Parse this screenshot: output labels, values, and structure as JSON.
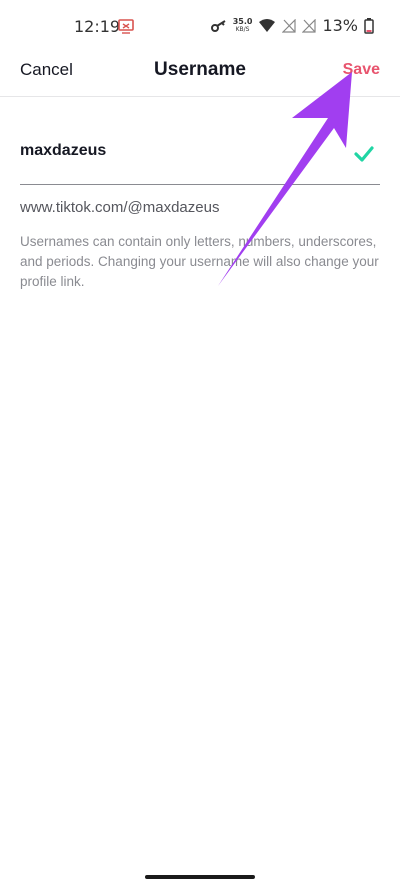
{
  "status_bar": {
    "time": "12:19",
    "net_speed_value": "35.0",
    "net_speed_unit": "KB/S",
    "battery_percent": "13%"
  },
  "nav": {
    "cancel_label": "Cancel",
    "title": "Username",
    "save_label": "Save"
  },
  "username_field": {
    "value": "maxdazeus",
    "valid_icon": "checkmark-icon"
  },
  "profile_link": "www.tiktok.com/@maxdazeus",
  "help_text": "Usernames can contain only letters, numbers, underscores, and periods. Changing your username will also change your profile link.",
  "colors": {
    "save_accent": "#e8546e",
    "check_green": "#20d5a4",
    "annotation_arrow": "#a13ef0"
  }
}
